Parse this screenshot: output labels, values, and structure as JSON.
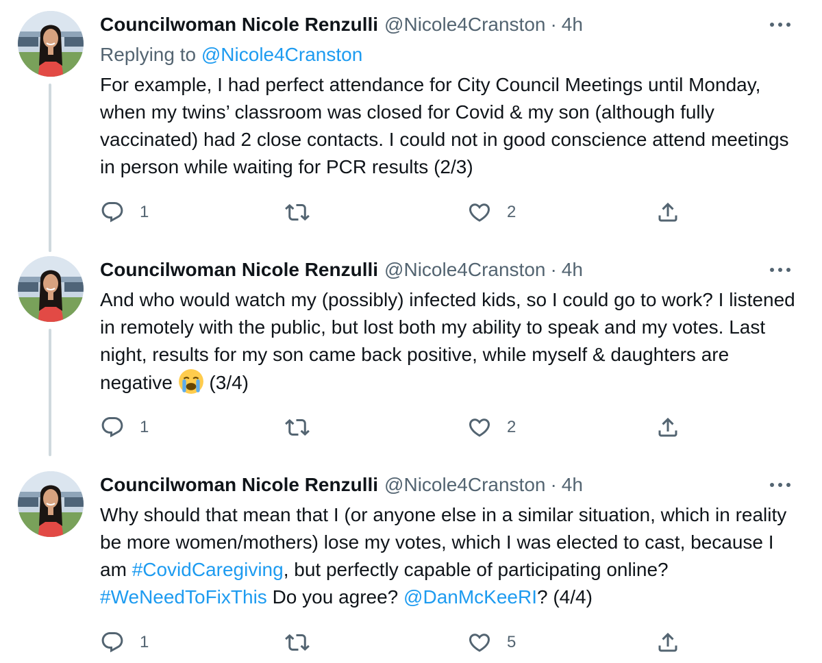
{
  "tweets": [
    {
      "name": "Councilwoman Nicole Renzulli",
      "handle": "@Nicole4Cranston",
      "separator": "·",
      "time": "4h",
      "replying_prefix": "Replying to",
      "replying_to": "@Nicole4Cranston",
      "text": "For example, I had perfect attendance for City Council Meetings until Monday, when my twins’ classroom was closed for Covid & my son (although fully vaccinated) had 2 close contacts. I could not in good conscience attend meetings in person while waiting for PCR results (2/3)",
      "replies": "1",
      "likes": "2"
    },
    {
      "name": "Councilwoman Nicole Renzulli",
      "handle": "@Nicole4Cranston",
      "separator": "·",
      "time": "4h",
      "text_before_emoji": "And who would watch my (possibly) infected kids, so I could go to work? I listened in remotely with the public, but lost both my ability to speak and my votes. Last night, results for my son came back positive, while myself & daughters are negative",
      "text_after_emoji": " (3/4)",
      "replies": "1",
      "likes": "2"
    },
    {
      "name": "Councilwoman Nicole Renzulli",
      "handle": "@Nicole4Cranston",
      "separator": "·",
      "time": "4h",
      "text_part1": "Why should that mean that I (or anyone else in a similar situation, which in reality be more women/mothers) lose my votes, which I was elected to cast, because I am ",
      "hashtag1": "#CovidCaregiving",
      "text_part2": ", but perfectly capable of participating online? ",
      "hashtag2": "#WeNeedToFixThis",
      "text_part3": " Do you agree? ",
      "mention": "@DanMcKeeRI",
      "text_part4": "? (4/4)",
      "replies": "1",
      "likes": "5"
    }
  ],
  "icons": {
    "reply": "reply-icon",
    "retweet": "retweet-icon",
    "like": "like-icon",
    "share": "share-icon",
    "more": "more-icon",
    "emoji": "crying-face-emoji"
  },
  "colors": {
    "link": "#1d9bf0",
    "secondary_text": "#536471",
    "primary_text": "#0f1419",
    "thread_line": "#cfd9de"
  }
}
